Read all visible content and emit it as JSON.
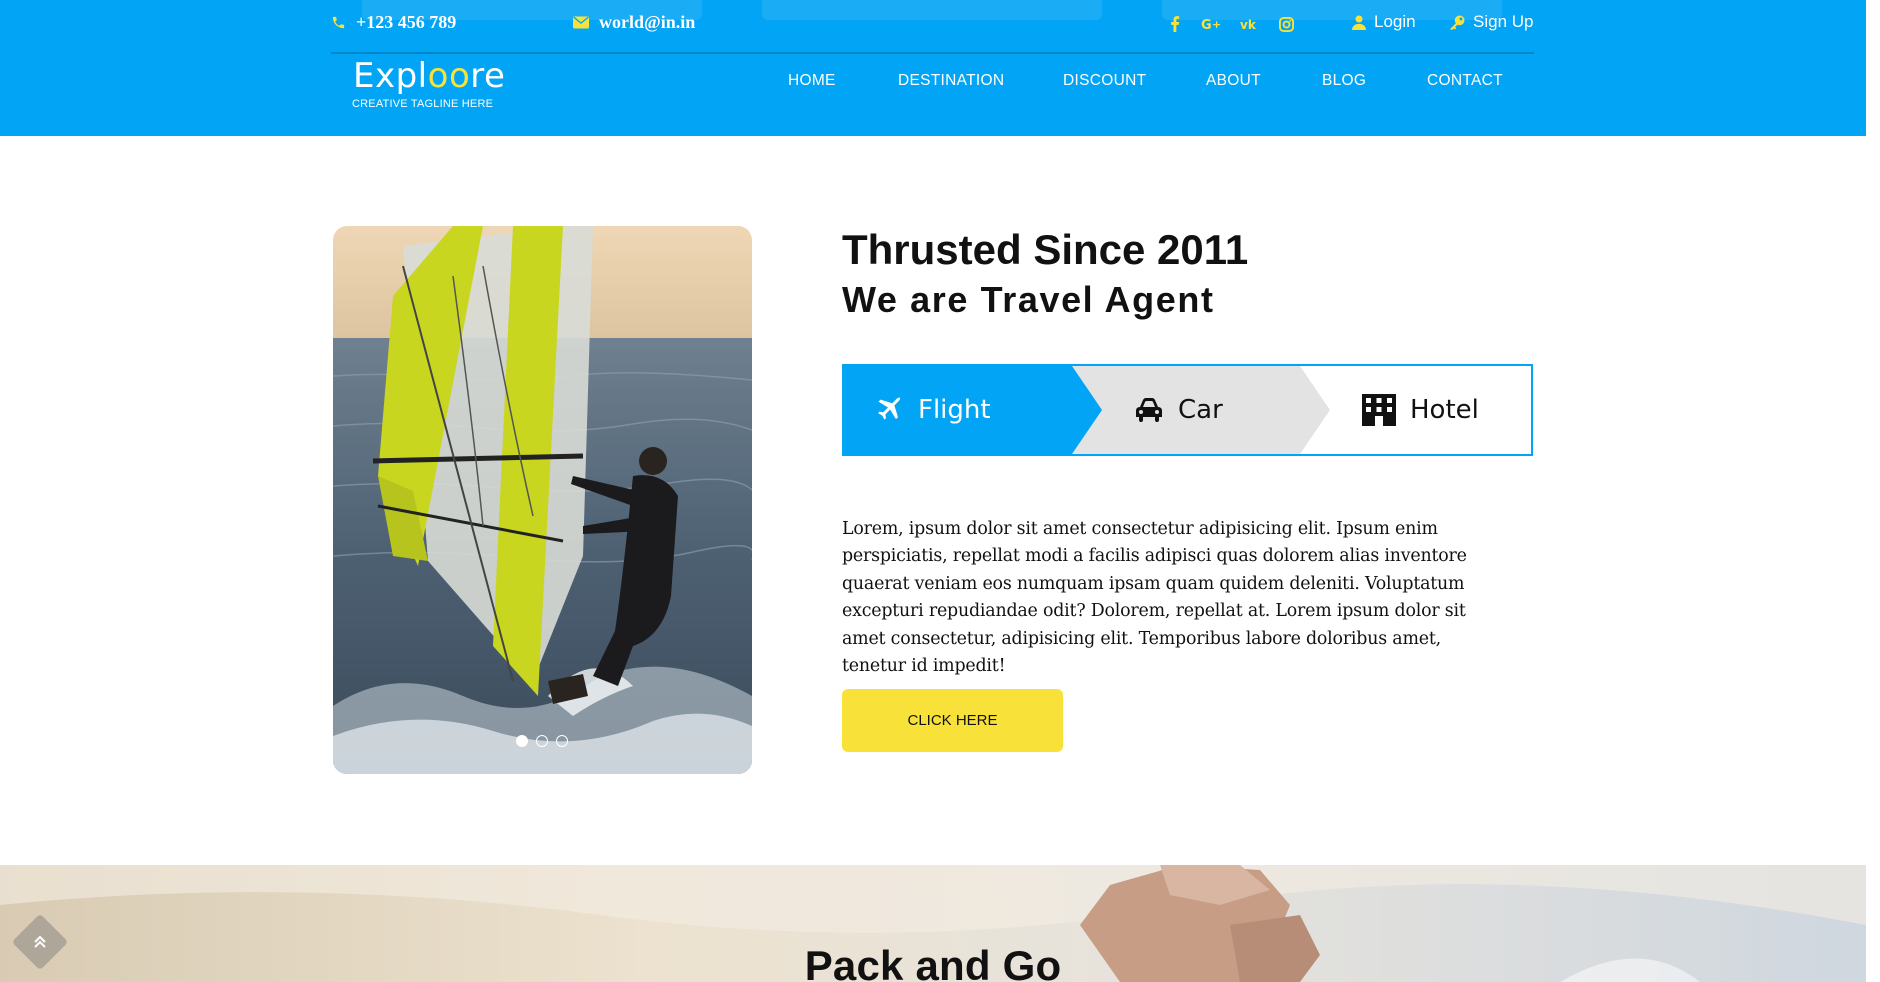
{
  "header": {
    "phone": "+123 456 789",
    "email": "world@in.in",
    "social_icons": [
      "facebook-icon",
      "google-plus-icon",
      "vk-icon",
      "instagram-icon"
    ],
    "login": "Login",
    "signup": "Sign Up",
    "logo": {
      "part1": "Expl",
      "part2": "oo",
      "part3": "re",
      "tagline": "CREATIVE TAGLINE HERE"
    },
    "nav": [
      "HOME",
      "DESTINATION",
      "DISCOUNT",
      "ABOUT",
      "BLOG",
      "CONTACT"
    ]
  },
  "about": {
    "title": "Thrusted Since 2011",
    "subtitle": "We are Travel Agent",
    "tabs": [
      {
        "label": "Flight",
        "icon": "plane-icon",
        "active": true
      },
      {
        "label": "Car",
        "icon": "car-icon",
        "active": false
      },
      {
        "label": "Hotel",
        "icon": "hotel-icon",
        "active": false
      }
    ],
    "paragraph": "Lorem, ipsum dolor sit amet consectetur adipisicing elit. Ipsum enim perspiciatis, repellat modi a facilis adipisci quas dolorem alias inventore quaerat veniam eos numquam ipsam quam quidem deleniti. Voluptatum excepturi repudiandae odit? Dolorem, repellat at. Lorem ipsum dolor sit amet consectetur, adipisicing elit. Temporibus labore doloribus amet, tenetur id impedit!",
    "button": "CLICK HERE",
    "slider_dots": 3,
    "active_dot": 0
  },
  "pack": {
    "title": "Pack and Go"
  },
  "colors": {
    "brand_blue": "#02a5f5",
    "accent_yellow": "#f8e23a",
    "tab_grey": "#e3e3e3"
  }
}
